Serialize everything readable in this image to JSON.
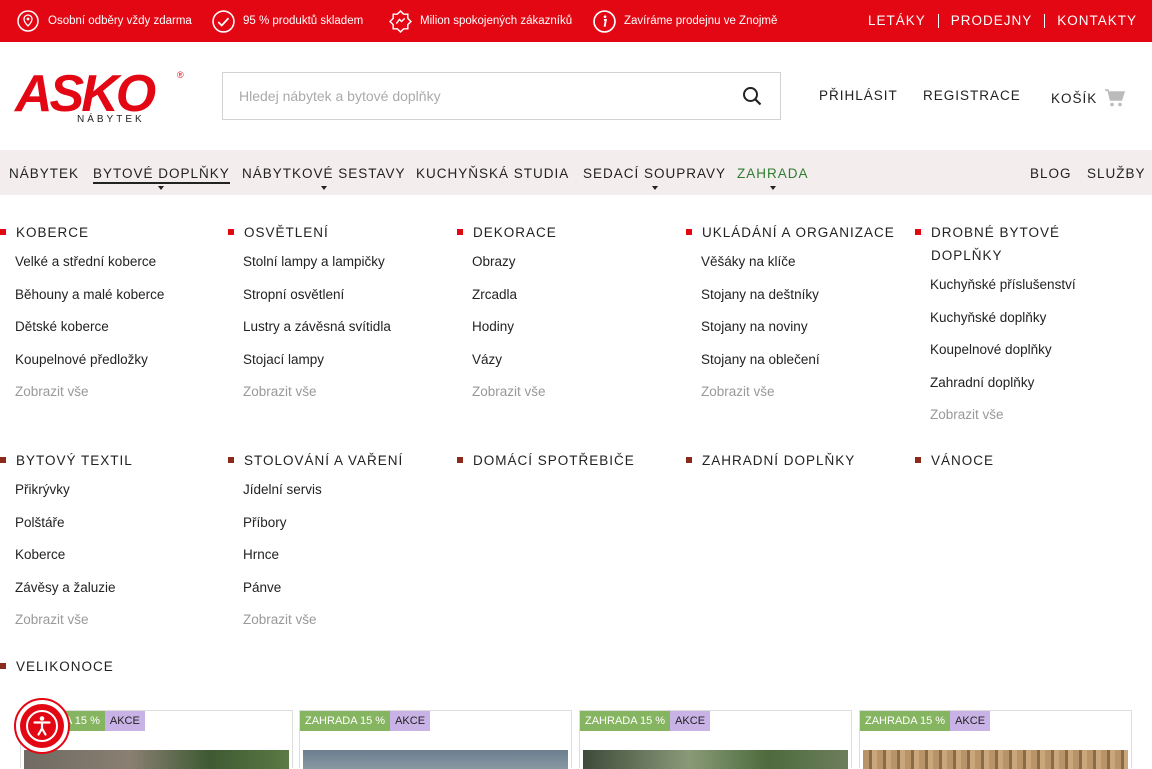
{
  "topbar": {
    "benefits": [
      {
        "icon": "map-pin-icon",
        "text": "Osobní odběry vždy zdarma"
      },
      {
        "icon": "check-circle-icon",
        "text": "95 % produktů skladem"
      },
      {
        "icon": "badge-icon",
        "text": "Milion spokojených zákazníků"
      },
      {
        "icon": "info-icon",
        "text": "Zavíráme prodejnu ve Znojmě"
      }
    ],
    "links": [
      "LETÁKY",
      "PRODEJNY",
      "KONTAKTY"
    ]
  },
  "header": {
    "logo": {
      "word": "ASKO",
      "sub": "NÁBYTEK",
      "reg": "®"
    },
    "search_placeholder": "Hledej nábytek a bytové doplňky",
    "login": "PŘIHLÁSIT",
    "register": "REGISTRACE",
    "cart": "KOŠÍK"
  },
  "nav": {
    "items": [
      "NÁBYTEK",
      "BYTOVÉ DOPLŇKY",
      "NÁBYTKOVÉ SESTAVY",
      "KUCHYŇSKÁ STUDIA",
      "SEDACÍ SOUPRAVY",
      "ZAHRADA"
    ],
    "right": [
      "BLOG",
      "SLUŽBY"
    ]
  },
  "mega": {
    "row1": [
      {
        "title": "KOBERCE",
        "items": [
          "Velké a střední koberce",
          "Běhouny a malé koberce",
          "Dětské koberce",
          "Koupelnové předložky",
          "Zobrazit vše"
        ]
      },
      {
        "title": "OSVĚTLENÍ",
        "items": [
          "Stolní lampy a lampičky",
          "Stropní osvětlení",
          "Lustry a závěsná svítidla",
          "Stojací lampy",
          "Zobrazit vše"
        ]
      },
      {
        "title": "DEKORACE",
        "items": [
          "Obrazy",
          "Zrcadla",
          "Hodiny",
          "Vázy",
          "Zobrazit vše"
        ]
      },
      {
        "title": "UKLÁDÁNÍ A ORGANIZACE",
        "items": [
          "Věšáky na klíče",
          "Stojany na deštníky",
          "Stojany na noviny",
          "Stojany na oblečení",
          "Zobrazit vše"
        ]
      },
      {
        "title": "DROBNÉ BYTOVÉ DOPLŇKY",
        "items": [
          "Kuchyňské příslušenství",
          "Kuchyňské doplňky",
          "Koupelnové doplňky",
          "Zahradní doplňky",
          "Zobrazit vše"
        ]
      }
    ],
    "row2": [
      {
        "title": "BYTOVÝ TEXTIL",
        "items": [
          "Přikrývky",
          "Polštáře",
          "Koberce",
          "Závěsy a žaluzie",
          "Zobrazit vše"
        ]
      },
      {
        "title": "STOLOVÁNÍ A VAŘENÍ",
        "items": [
          "Jídelní servis",
          "Příbory",
          "Hrnce",
          "Pánve",
          "Zobrazit vše"
        ]
      },
      {
        "title": "DOMÁCÍ SPOTŘEBIČE",
        "items": []
      },
      {
        "title": "ZAHRADNÍ DOPLŇKY",
        "items": []
      },
      {
        "title": "VÁNOCE",
        "items": []
      }
    ],
    "row3": [
      {
        "title": "VELIKONOCE",
        "items": []
      }
    ]
  },
  "products": {
    "tag_green": "ZAHRADA 15 %",
    "tag_first": "A 15 %",
    "tag_akce": "AKCE"
  }
}
